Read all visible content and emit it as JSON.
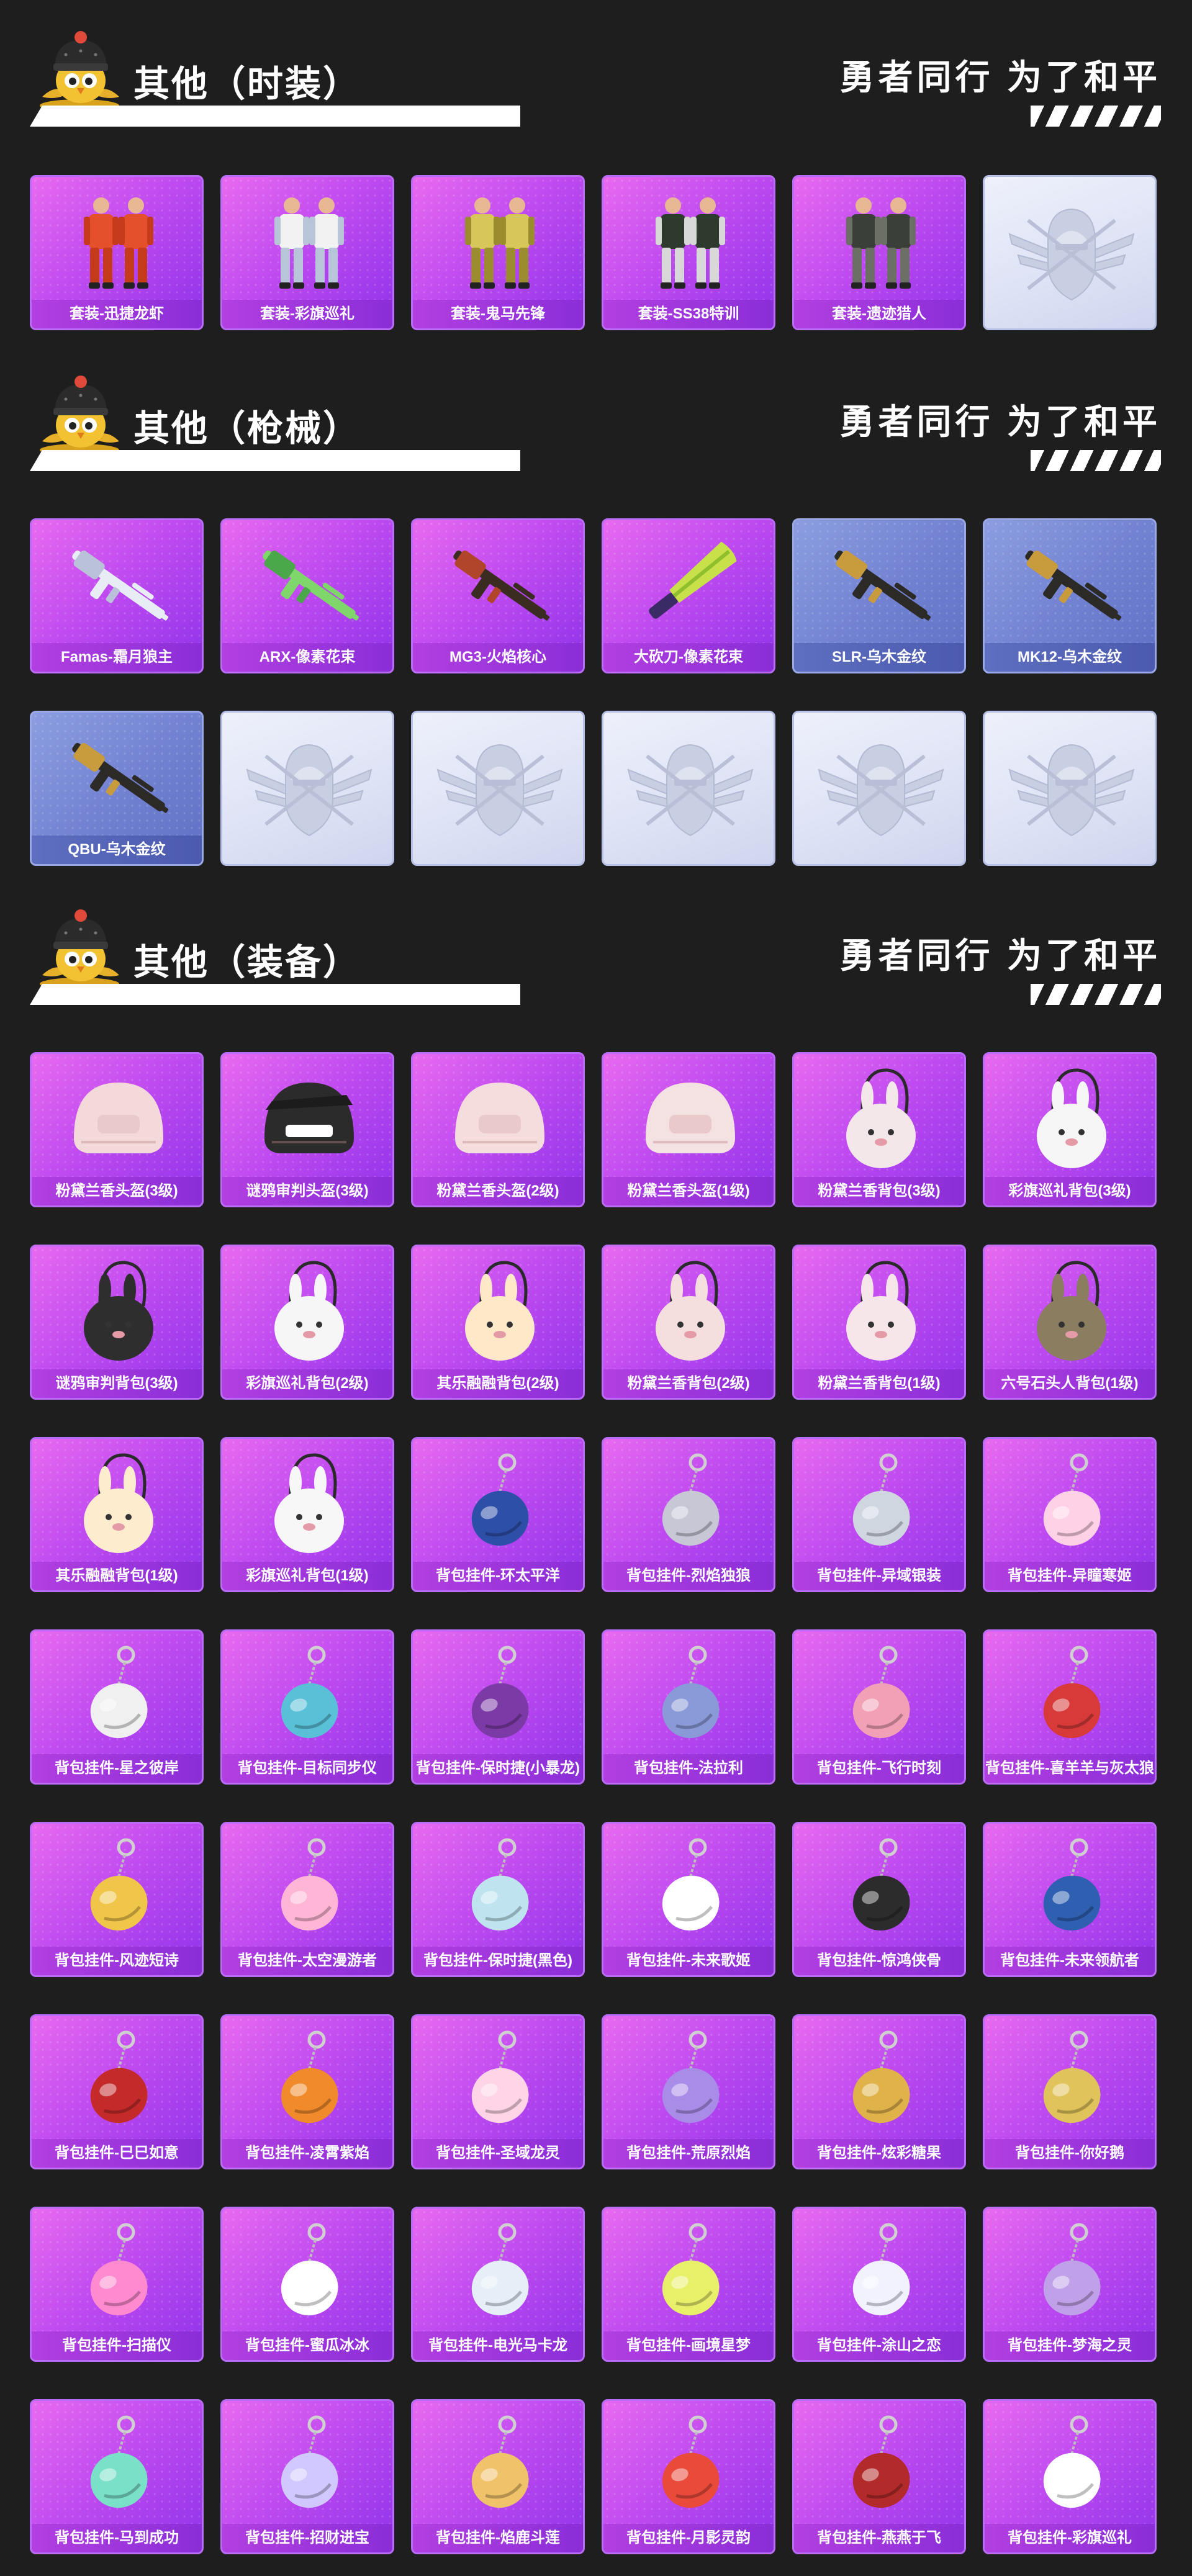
{
  "sections": [
    {
      "title": "其他（时装）",
      "slogan": "勇者同行 为了和平",
      "items": [
        {
          "label": "套装-迅捷龙虾",
          "kind": "outfit",
          "tier": "purple",
          "icon": "outfit-icon"
        },
        {
          "label": "套装-彩旗巡礼",
          "kind": "outfit",
          "tier": "purple",
          "icon": "outfit-icon"
        },
        {
          "label": "套装-鬼马先锋",
          "kind": "outfit",
          "tier": "purple",
          "icon": "outfit-icon"
        },
        {
          "label": "套装-SS38特训",
          "kind": "outfit",
          "tier": "purple",
          "icon": "outfit-icon"
        },
        {
          "label": "套装-遗迹猎人",
          "kind": "outfit",
          "tier": "purple",
          "icon": "outfit-icon"
        },
        {
          "label": "",
          "kind": "empty",
          "tier": "empty",
          "icon": "emblem-icon"
        }
      ]
    },
    {
      "title": "其他（枪械）",
      "slogan": "勇者同行 为了和平",
      "items": [
        {
          "label": "Famas-霜月狼主",
          "kind": "gun",
          "tier": "purple",
          "icon": "rifle-icon"
        },
        {
          "label": "ARX-像素花束",
          "kind": "gun",
          "tier": "purple",
          "icon": "rifle-icon"
        },
        {
          "label": "MG3-火焰核心",
          "kind": "gun",
          "tier": "purple",
          "icon": "machine-gun-icon"
        },
        {
          "label": "大砍刀-像素花束",
          "kind": "blade",
          "tier": "purple",
          "icon": "machete-icon"
        },
        {
          "label": "SLR-乌木金纹",
          "kind": "gun",
          "tier": "blue",
          "icon": "rifle-icon"
        },
        {
          "label": "MK12-乌木金纹",
          "kind": "gun",
          "tier": "blue",
          "icon": "rifle-icon"
        },
        {
          "label": "QBU-乌木金纹",
          "kind": "gun",
          "tier": "blue",
          "icon": "rifle-icon"
        },
        {
          "label": "",
          "kind": "empty",
          "tier": "empty",
          "icon": "emblem-icon"
        },
        {
          "label": "",
          "kind": "empty",
          "tier": "empty",
          "icon": "emblem-icon"
        },
        {
          "label": "",
          "kind": "empty",
          "tier": "empty",
          "icon": "emblem-icon"
        },
        {
          "label": "",
          "kind": "empty",
          "tier": "empty",
          "icon": "emblem-icon"
        },
        {
          "label": "",
          "kind": "empty",
          "tier": "empty",
          "icon": "emblem-icon"
        }
      ]
    },
    {
      "title": "其他（装备）",
      "slogan": "勇者同行 为了和平",
      "items": [
        {
          "label": "粉黛兰香头盔(3级)",
          "kind": "helmet",
          "tier": "purple",
          "icon": "helmet-icon"
        },
        {
          "label": "谜鸦审判头盔(3级)",
          "kind": "helmet",
          "tier": "purple",
          "icon": "helmet-icon"
        },
        {
          "label": "粉黛兰香头盔(2级)",
          "kind": "helmet",
          "tier": "purple",
          "icon": "helmet-icon"
        },
        {
          "label": "粉黛兰香头盔(1级)",
          "kind": "helmet",
          "tier": "purple",
          "icon": "helmet-icon"
        },
        {
          "label": "粉黛兰香背包(3级)",
          "kind": "backpack",
          "tier": "purple",
          "icon": "backpack-icon"
        },
        {
          "label": "彩旗巡礼背包(3级)",
          "kind": "backpack",
          "tier": "purple",
          "icon": "backpack-icon"
        },
        {
          "label": "谜鸦审判背包(3级)",
          "kind": "backpack",
          "tier": "purple",
          "icon": "backpack-icon"
        },
        {
          "label": "彩旗巡礼背包(2级)",
          "kind": "backpack",
          "tier": "purple",
          "icon": "backpack-icon"
        },
        {
          "label": "其乐融融背包(2级)",
          "kind": "backpack",
          "tier": "purple",
          "icon": "backpack-icon"
        },
        {
          "label": "粉黛兰香背包(2级)",
          "kind": "backpack",
          "tier": "purple",
          "icon": "backpack-icon"
        },
        {
          "label": "粉黛兰香背包(1级)",
          "kind": "backpack",
          "tier": "purple",
          "icon": "backpack-icon"
        },
        {
          "label": "六号石头人背包(1级)",
          "kind": "backpack",
          "tier": "purple",
          "icon": "backpack-icon"
        },
        {
          "label": "其乐融融背包(1级)",
          "kind": "backpack",
          "tier": "purple",
          "icon": "backpack-icon"
        },
        {
          "label": "彩旗巡礼背包(1级)",
          "kind": "backpack",
          "tier": "purple",
          "icon": "backpack-icon"
        },
        {
          "label": "背包挂件-环太平洋",
          "kind": "charm",
          "tier": "purple",
          "icon": "charm-icon"
        },
        {
          "label": "背包挂件-烈焰独狼",
          "kind": "charm",
          "tier": "purple",
          "icon": "charm-icon"
        },
        {
          "label": "背包挂件-异域银装",
          "kind": "charm",
          "tier": "purple",
          "icon": "charm-icon"
        },
        {
          "label": "背包挂件-异瞳寒姬",
          "kind": "charm",
          "tier": "purple",
          "icon": "charm-icon"
        },
        {
          "label": "背包挂件-星之彼岸",
          "kind": "charm",
          "tier": "purple",
          "icon": "charm-icon"
        },
        {
          "label": "背包挂件-目标同步仪",
          "kind": "charm",
          "tier": "purple",
          "icon": "charm-icon"
        },
        {
          "label": "背包挂件-保时捷(小暴龙)",
          "kind": "charm",
          "tier": "purple",
          "icon": "charm-icon"
        },
        {
          "label": "背包挂件-法拉利",
          "kind": "charm",
          "tier": "purple",
          "icon": "charm-icon"
        },
        {
          "label": "背包挂件-飞行时刻",
          "kind": "charm",
          "tier": "purple",
          "icon": "charm-icon"
        },
        {
          "label": "背包挂件-喜羊羊与灰太狼",
          "kind": "charm",
          "tier": "purple",
          "icon": "charm-icon"
        },
        {
          "label": "背包挂件-风迹短诗",
          "kind": "charm",
          "tier": "purple",
          "icon": "charm-icon"
        },
        {
          "label": "背包挂件-太空漫游者",
          "kind": "charm",
          "tier": "purple",
          "icon": "charm-icon"
        },
        {
          "label": "背包挂件-保时捷(黑色)",
          "kind": "charm",
          "tier": "purple",
          "icon": "charm-icon"
        },
        {
          "label": "背包挂件-未来歌姬",
          "kind": "charm",
          "tier": "purple",
          "icon": "charm-icon"
        },
        {
          "label": "背包挂件-惊鸿侠骨",
          "kind": "charm",
          "tier": "purple",
          "icon": "charm-icon"
        },
        {
          "label": "背包挂件-未来领航者",
          "kind": "charm",
          "tier": "purple",
          "icon": "charm-icon"
        },
        {
          "label": "背包挂件-巳巳如意",
          "kind": "charm",
          "tier": "purple",
          "icon": "charm-icon"
        },
        {
          "label": "背包挂件-凌霄紫焰",
          "kind": "charm",
          "tier": "purple",
          "icon": "charm-icon"
        },
        {
          "label": "背包挂件-圣域龙灵",
          "kind": "charm",
          "tier": "purple",
          "icon": "charm-icon"
        },
        {
          "label": "背包挂件-荒原烈焰",
          "kind": "charm",
          "tier": "purple",
          "icon": "charm-icon"
        },
        {
          "label": "背包挂件-炫彩糖果",
          "kind": "charm",
          "tier": "purple",
          "icon": "charm-icon"
        },
        {
          "label": "背包挂件-你好鹅",
          "kind": "charm",
          "tier": "purple",
          "icon": "charm-icon"
        },
        {
          "label": "背包挂件-扫描仪",
          "kind": "charm",
          "tier": "purple",
          "icon": "charm-icon"
        },
        {
          "label": "背包挂件-蜜瓜冰冰",
          "kind": "charm",
          "tier": "purple",
          "icon": "charm-icon"
        },
        {
          "label": "背包挂件-电光马卡龙",
          "kind": "charm",
          "tier": "purple",
          "icon": "charm-icon"
        },
        {
          "label": "背包挂件-画境星梦",
          "kind": "charm",
          "tier": "purple",
          "icon": "charm-icon"
        },
        {
          "label": "背包挂件-涂山之恋",
          "kind": "charm",
          "tier": "purple",
          "icon": "charm-icon"
        },
        {
          "label": "背包挂件-梦海之灵",
          "kind": "charm",
          "tier": "purple",
          "icon": "charm-icon"
        },
        {
          "label": "背包挂件-马到成功",
          "kind": "charm",
          "tier": "purple",
          "icon": "charm-icon"
        },
        {
          "label": "背包挂件-招财进宝",
          "kind": "charm",
          "tier": "purple",
          "icon": "charm-icon"
        },
        {
          "label": "背包挂件-焰鹿斗莲",
          "kind": "charm",
          "tier": "purple",
          "icon": "charm-icon"
        },
        {
          "label": "背包挂件-月影灵韵",
          "kind": "charm",
          "tier": "purple",
          "icon": "charm-icon"
        },
        {
          "label": "背包挂件-燕燕于飞",
          "kind": "charm",
          "tier": "purple",
          "icon": "charm-icon"
        },
        {
          "label": "背包挂件-彩旗巡礼",
          "kind": "charm",
          "tier": "purple",
          "icon": "charm-icon"
        }
      ]
    }
  ],
  "mascot_icon": "bird-mascot-icon",
  "colors": {
    "background": "#1e1e1e",
    "purple_card": "#c04bf0",
    "blue_card": "#7383d2",
    "empty_card": "#dde2f5",
    "text": "#ffffff"
  }
}
